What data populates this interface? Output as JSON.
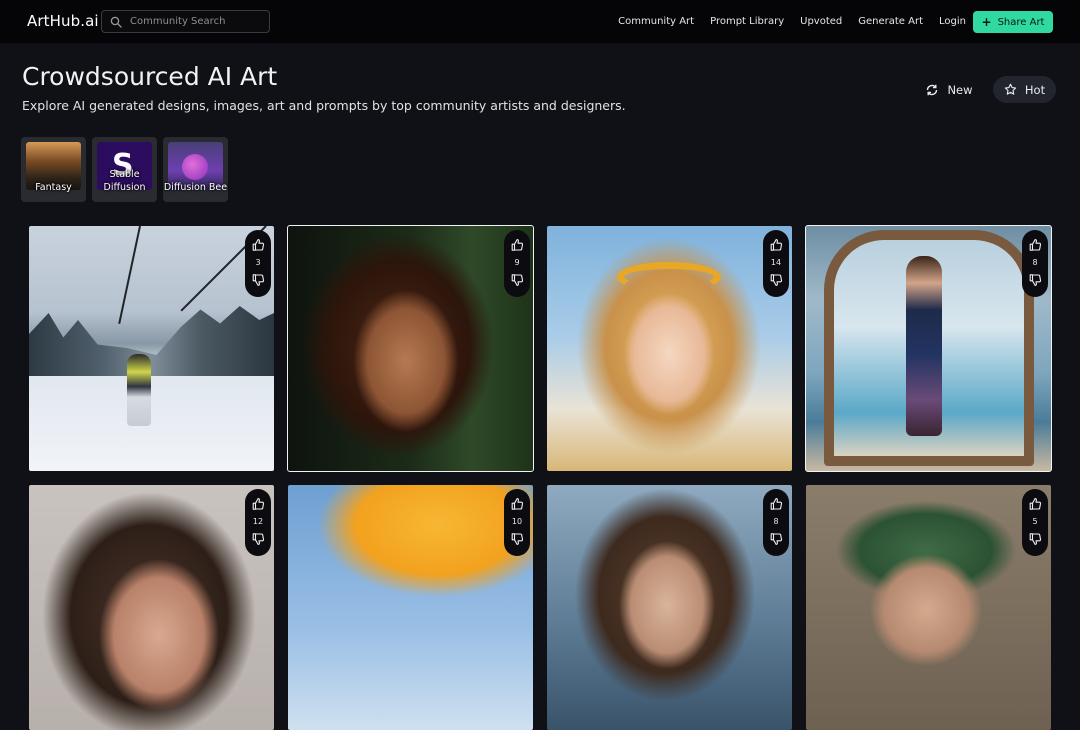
{
  "app": {
    "logo": "ArtHub.ai"
  },
  "search": {
    "placeholder": "Community Search",
    "value": ""
  },
  "nav": {
    "items": [
      {
        "label": "Community Art"
      },
      {
        "label": "Prompt Library"
      },
      {
        "label": "Upvoted"
      },
      {
        "label": "Generate Art"
      },
      {
        "label": "Login"
      }
    ],
    "share_label": "Share Art"
  },
  "header": {
    "title": "Crowdsourced AI Art",
    "subtitle": "Explore AI generated designs, images, art and prompts by top community artists and designers."
  },
  "sort": {
    "new_label": "New",
    "hot_label": "Hot",
    "active": "Hot"
  },
  "categories": [
    {
      "label": "Fantasy"
    },
    {
      "label": "Stable Diffusion"
    },
    {
      "label": "Diffusion Bee"
    }
  ],
  "gallery": [
    {
      "votes": "3"
    },
    {
      "votes": "9"
    },
    {
      "votes": "14"
    },
    {
      "votes": "8"
    },
    {
      "votes": "12"
    },
    {
      "votes": "10"
    },
    {
      "votes": "8"
    },
    {
      "votes": "5"
    }
  ],
  "colors": {
    "accent": "#2fd9a0",
    "background": "#101116",
    "topbar": "#050507"
  },
  "icons": {
    "search": "search-icon",
    "share": "plus-icon",
    "new": "refresh-icon",
    "hot": "star-icon",
    "upvote": "thumbs-up-icon",
    "downvote": "thumbs-down-icon"
  }
}
